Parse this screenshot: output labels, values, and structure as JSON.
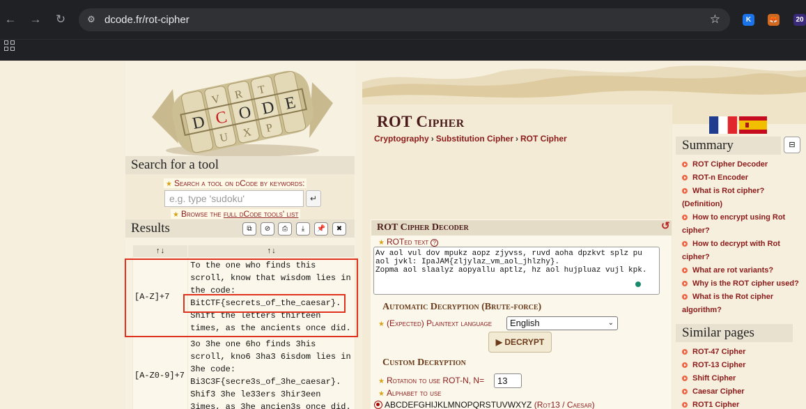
{
  "browser": {
    "url": "dcode.fr/rot-cipher",
    "ext_badge": "20"
  },
  "site": {
    "logo_text": "dCODE"
  },
  "search_box": {
    "title": "Search for a tool",
    "keywords_label": "Search a tool on dCode by keywords:",
    "placeholder": "e.g. type 'sudoku'",
    "browse_prefix": "Browse the ",
    "browse_link": "full dCode tools' list"
  },
  "results": {
    "title": "Results",
    "headers": [
      "↑↓",
      "↑↓"
    ],
    "rows": [
      {
        "key": "[A-Z]+7",
        "value": "To the one who finds this scroll, know that wisdom lies in the code: BitCTF{secrets_of_the_caesar}. Shift the letters thirteen times, as the ancients once did."
      },
      {
        "key": "[A-Z0-9]+7",
        "value": "3o 3he one 6ho finds 3his scroll, kno6 3ha3 6isdom lies in 3he code: Bi3C3F{secre3s_of_3he_caesar}. Shif3 3he le33ers 3hir3een 3imes, as 3he ancien3s once did."
      }
    ]
  },
  "page": {
    "title": "ROT Cipher",
    "breadcrumb": [
      "Cryptography",
      "Substitution Cipher",
      "ROT Cipher"
    ]
  },
  "decoder": {
    "title": "ROT Cipher Decoder",
    "rot_label": "ROTed text",
    "ciphertext": "Av aol vul dov mpukz aopz zjyvss, ruvd aoha dpzkvt splz pu aol jvkl: IpaJAM{zljylaz_vm_aol_jhlzhy}.\nZopma aol slaalyz aopyallu aptlz, hz aol hujpluaz vujl kpk.",
    "auto_title": "Automatic Decryption (Brute-force)",
    "lang_label": "(Expected) Plaintext language",
    "lang_value": "English",
    "decrypt_label": "▶ DECRYPT",
    "custom_title": "Custom Decryption",
    "rotation_label": "Rotation to use ROT-N, N=",
    "rotation_value": "13",
    "alphabet_label": "Alphabet to use",
    "alphabet_option": "ABCDEFGHIJKLMNOPQRSTUVWXYZ",
    "alphabet_option_note": "(Rot13 / Caesar)"
  },
  "summary": {
    "title": "Summary",
    "items": [
      "ROT Cipher Decoder",
      "ROT-n Encoder",
      "What is Rot cipher? (Definition)",
      "How to encrypt using Rot cipher?",
      "How to decrypt with Rot cipher?",
      "What are rot variants?",
      "Why is the ROT cipher used?",
      "What is the Rot cipher algorithm?"
    ]
  },
  "similar": {
    "title": "Similar pages",
    "items": [
      "ROT-47 Cipher",
      "ROT-13 Cipher",
      "Shift Cipher",
      "Caesar Cipher",
      "ROT1 Cipher"
    ]
  },
  "colors": {
    "link": "#8b1a1a",
    "highlight": "#e0301e",
    "chrome": "#202124"
  }
}
